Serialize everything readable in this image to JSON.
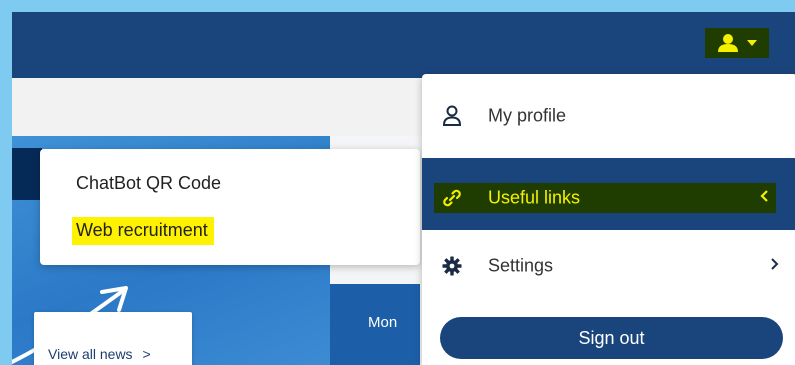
{
  "header": {
    "user_menu_icon": "user-icon",
    "user_menu_caret": "caret-down-icon"
  },
  "popup": {
    "items": [
      {
        "label": "ChatBot QR Code"
      },
      {
        "label": "Web recruitment"
      }
    ]
  },
  "user_menu": {
    "items": [
      {
        "label": "My profile",
        "icon": "user-outline-icon"
      },
      {
        "label": "Useful links",
        "icon": "link-icon"
      },
      {
        "label": "Settings",
        "icon": "gear-icon"
      }
    ],
    "sign_out_label": "Sign out"
  },
  "news": {
    "view_all_label": "View all news",
    "view_all_chevron": ">"
  },
  "calendar": {
    "day_label": "Mon"
  },
  "colors": {
    "frame": "#7fcaf0",
    "primary": "#1a457c",
    "highlight_dark": "#1f3d00",
    "highlight_text": "#f5f000",
    "marker_yellow": "#fff200",
    "hero_blue": "#2b79c7"
  }
}
